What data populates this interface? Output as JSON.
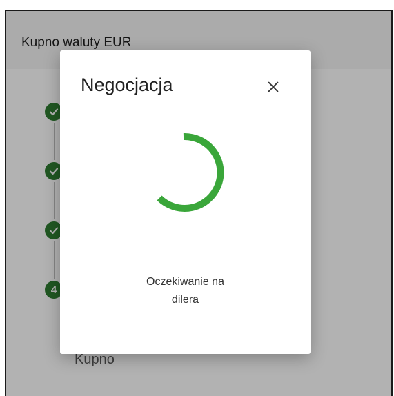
{
  "header": {
    "title": "Kupno waluty EUR"
  },
  "steps": [
    {
      "state": "done",
      "icon": "check-icon"
    },
    {
      "state": "done",
      "icon": "check-icon"
    },
    {
      "state": "done",
      "icon": "check-icon"
    },
    {
      "state": "current",
      "number": "4"
    }
  ],
  "content": {
    "bottom_label": "Kupno"
  },
  "dialog": {
    "title": "Negocjacja",
    "close_icon": "close-icon",
    "spinner_icon": "loading-spinner",
    "status_line1": "Oczekiwanie na",
    "status_line2": "dilera"
  },
  "colors": {
    "accent_green": "#2e7d32",
    "spinner_green": "#3aa63a",
    "overlay": "rgba(0,0,0,0.30)"
  }
}
